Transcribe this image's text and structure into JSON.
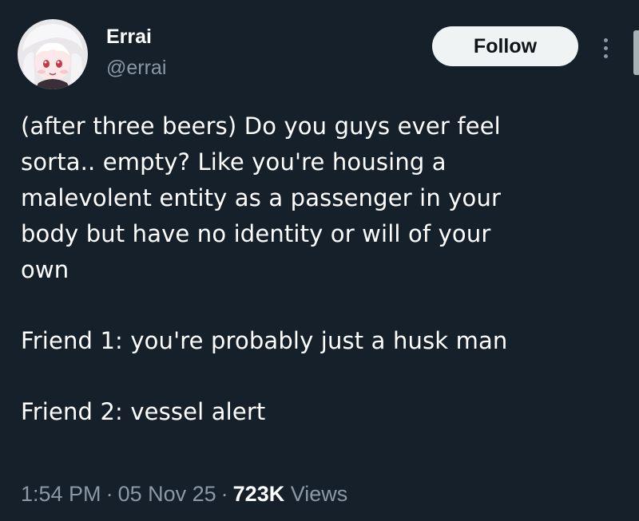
{
  "author": {
    "display_name": "Errai",
    "handle": "@errai",
    "avatar_icon": "anime-avatar-icon"
  },
  "follow_label": "Follow",
  "tweet": {
    "lines": [
      "(after three beers) Do you guys ever feel",
      "sorta.. empty? Like you're housing a",
      "malevolent entity as a passenger in your",
      "body but have no identity or will of your",
      "own"
    ],
    "friend1": "Friend 1: you're probably just a husk man",
    "friend2": "Friend 2: vessel alert"
  },
  "meta": {
    "time": "1:54 PM",
    "separator": "·",
    "date": "05 Nov 25",
    "views_count": "723K",
    "views_label": "Views"
  },
  "colors": {
    "background": "#15202b",
    "secondary_text": "#8b98a5",
    "button_bg": "#eff3f4",
    "button_text": "#0f1419"
  }
}
